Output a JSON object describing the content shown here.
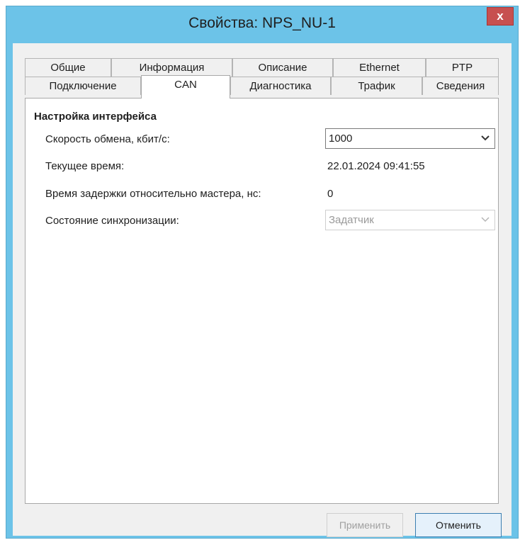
{
  "window": {
    "title": "Свойства: NPS_NU-1",
    "close_label": "x"
  },
  "tabs": {
    "row1": [
      "Общие",
      "Информация",
      "Описание",
      "Ethernet",
      "PTP"
    ],
    "row2": [
      "Подключение",
      "CAN",
      "Диагностика",
      "Трафик",
      "Сведения"
    ],
    "active": "CAN"
  },
  "can_panel": {
    "group_title": "Настройка интерфейса",
    "speed_label": "Скорость обмена, кбит/с:",
    "speed_value": "1000",
    "time_label": "Текущее время:",
    "time_value": "22.01.2024 09:41:55",
    "delay_label": "Время задержки относительно мастера, нс:",
    "delay_value": "0",
    "sync_label": "Состояние синхронизации:",
    "sync_value": "Задатчик"
  },
  "buttons": {
    "apply": "Применить",
    "cancel": "Отменить"
  },
  "icons": {
    "dropdown": "chevron-down-icon",
    "close": "close-icon"
  }
}
